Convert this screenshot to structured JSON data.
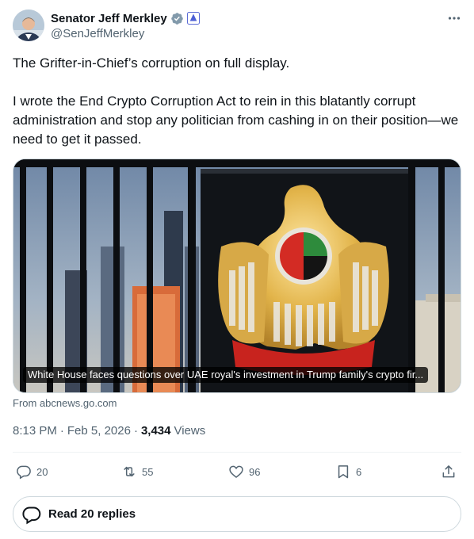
{
  "author": {
    "display_name": "Senator Jeff Merkley",
    "handle": "@SenJeffMerkley",
    "verified_icon": "verified-badge-icon",
    "affiliation_icon": "government-affiliation-icon"
  },
  "tweet": {
    "paragraphs": [
      "The Grifter-in-Chief’s corruption on full display.",
      "I wrote the End Crypto Corruption Act to rein in this blatantly corrupt administration and stop any politician from cashing in on their position—we need to get it passed."
    ]
  },
  "card": {
    "caption": "White House faces questions over UAE royal's investment in Trump family's crypto fir...",
    "source": "From abcnews.go.com"
  },
  "meta": {
    "time": "8:13 PM",
    "separator": "·",
    "date": "Feb 5, 2026",
    "views_count": "3,434",
    "views_label": "Views"
  },
  "actions": {
    "replies": "20",
    "reposts": "55",
    "likes": "96",
    "bookmarks": "6"
  },
  "read_replies": {
    "label": "Read 20 replies"
  },
  "colors": {
    "text_primary": "#0f1419",
    "text_secondary": "#536471",
    "verified_blue": "#1d9bf0",
    "border": "#cfd9de"
  }
}
